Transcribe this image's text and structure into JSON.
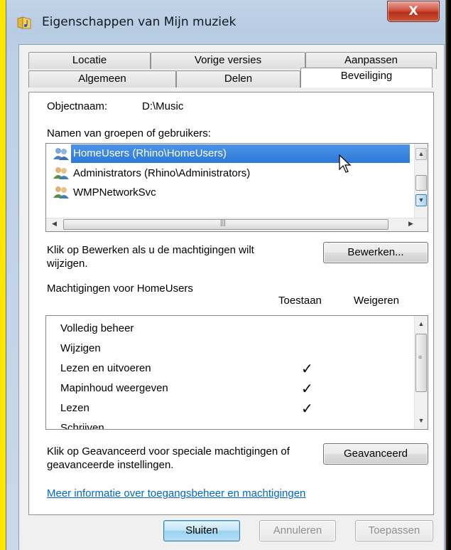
{
  "window": {
    "title": "Eigenschappen van Mijn muziek",
    "close_label": "X"
  },
  "tabs": {
    "row_top": [
      "Locatie",
      "Vorige versies",
      "Aanpassen"
    ],
    "row_bottom": [
      "Algemeen",
      "Delen",
      "Beveiliging"
    ],
    "active": "Beveiliging"
  },
  "object": {
    "label": "Objectnaam:",
    "value": "D:\\Music"
  },
  "groups": {
    "label": "Namen van groepen of gebruikers:",
    "items": [
      "HomeUsers (Rhino\\HomeUsers)",
      "Administrators (Rhino\\Administrators)",
      "WMPNetworkSvc"
    ],
    "selected_index": 0
  },
  "edit": {
    "hint": "Klik op Bewerken als u de machtigingen wilt wijzigen.",
    "button": "Bewerken..."
  },
  "permissions": {
    "title": "Machtigingen voor HomeUsers",
    "col_allow": "Toestaan",
    "col_deny": "Weigeren",
    "rows": [
      {
        "name": "Volledig beheer",
        "allow": false,
        "deny": false
      },
      {
        "name": "Wijzigen",
        "allow": false,
        "deny": false
      },
      {
        "name": "Lezen en uitvoeren",
        "allow": true,
        "deny": false
      },
      {
        "name": "Mapinhoud weergeven",
        "allow": true,
        "deny": false
      },
      {
        "name": "Lezen",
        "allow": true,
        "deny": false
      },
      {
        "name": "Schrijven",
        "allow": false,
        "deny": false
      }
    ],
    "check_glyph": "✓"
  },
  "advanced": {
    "hint": "Klik op Geavanceerd voor speciale machtigingen of geavanceerde instellingen.",
    "button": "Geavanceerd"
  },
  "info_link": "Meer informatie over toegangsbeheer en machtigingen",
  "footer": {
    "close": "Sluiten",
    "cancel": "Annuleren",
    "apply": "Toepassen"
  },
  "colors": {
    "frame_yellow": "#ffe600",
    "selection_blue": "#3483de",
    "link_blue": "#0066cc"
  }
}
